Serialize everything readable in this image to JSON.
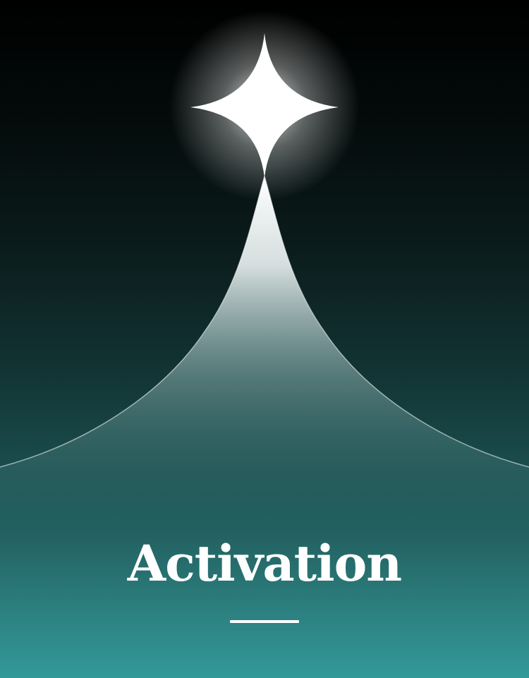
{
  "poster": {
    "title": "Activation",
    "colors": {
      "top": "#000000",
      "mid": "#123434",
      "bottom": "#339999",
      "star": "#ffffff",
      "text": "#ffffff"
    }
  },
  "decorations": {
    "main_icon": "four-point-star-icon",
    "trail": "light-beam-trail"
  }
}
